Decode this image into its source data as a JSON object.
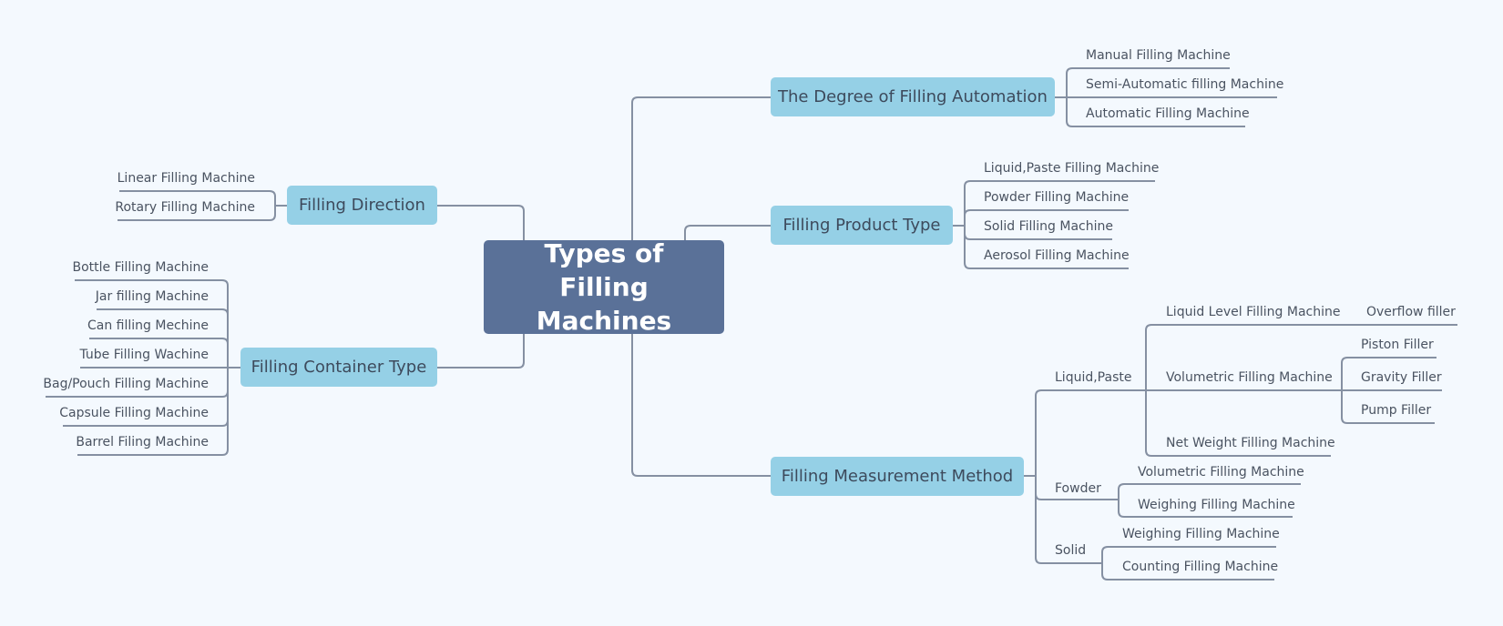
{
  "root": {
    "label": "Types of Filling Machines"
  },
  "branches": {
    "automation": {
      "label": "The Degree of Filling Automation",
      "children": [
        "Manual Filling Machine",
        "Semi-Automatic filling Machine",
        "Automatic Filling Machine"
      ]
    },
    "product": {
      "label": "Filling Product Type",
      "children": [
        "Liquid,Paste Filling Machine",
        "Powder Filling Machine",
        "Solid Filling Machine",
        "Aerosol Filling Machine"
      ]
    },
    "direction": {
      "label": "Filling Direction",
      "children": [
        "Linear Filling Machine",
        "Rotary Filling Machine"
      ]
    },
    "container": {
      "label": "Filling Container Type",
      "children": [
        "Bottle Filling Machine",
        "Jar filling Machine",
        "Can filling Mechine",
        "Tube Filling Wachine",
        "Bag/Pouch Filling Machine",
        "Capsule Filling Machine",
        "Barrel Filing Machine"
      ]
    },
    "measurement": {
      "label": "Filling Measurement Method",
      "liquid": {
        "label": "Liquid,Paste",
        "level": {
          "label": "Liquid Level Filling Machine",
          "children": [
            "Overflow filler"
          ]
        },
        "volumetric": {
          "label": "Volumetric Filling Machine",
          "children": [
            "Piston Filler",
            "Gravity Filler",
            "Pump Filler"
          ]
        },
        "netweight": {
          "label": "Net Weight Filling Machine"
        }
      },
      "powder": {
        "label": "Fowder",
        "children": [
          "Volumetric Filling Machine",
          "Weighing Filling Machine"
        ]
      },
      "solid": {
        "label": "Solid",
        "children": [
          "Weighing Filling Machine",
          "Counting Filling Machine"
        ]
      }
    }
  }
}
